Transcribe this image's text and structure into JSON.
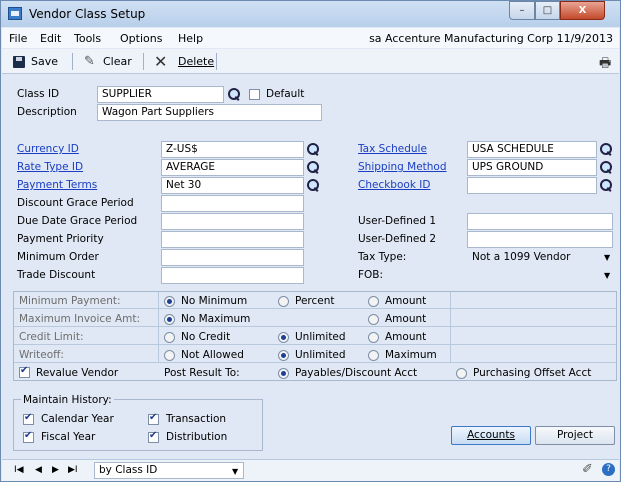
{
  "window": {
    "title": "Vendor Class Setup",
    "min": "–",
    "max": "□",
    "close": "X"
  },
  "menu": {
    "items": [
      "File",
      "Edit",
      "Tools",
      "Options",
      "Help"
    ],
    "company": "sa  Accenture Manufacturing Corp  11/9/2013"
  },
  "toolbar": {
    "save": "Save",
    "clear": "Clear",
    "delete": "Delete"
  },
  "header": {
    "class_id_label": "Class ID",
    "class_id": "SUPPLIER",
    "default_label": "Default",
    "description_label": "Description",
    "description": "Wagon Part Suppliers"
  },
  "fields": {
    "currency_id_label": "Currency ID",
    "currency_id": "Z-US$",
    "rate_type_label": "Rate Type ID",
    "rate_type": "AVERAGE",
    "payment_terms_label": "Payment Terms",
    "payment_terms": "Net 30",
    "discount_grace_label": "Discount Grace Period",
    "discount_grace": "",
    "due_date_grace_label": "Due Date Grace Period",
    "due_date_grace": "",
    "payment_priority_label": "Payment Priority",
    "payment_priority": "",
    "minimum_order_label": "Minimum Order",
    "minimum_order": "",
    "trade_discount_label": "Trade Discount",
    "trade_discount": "",
    "tax_schedule_label": "Tax Schedule",
    "tax_schedule": "USA SCHEDULE",
    "shipping_method_label": "Shipping Method",
    "shipping_method": "UPS GROUND",
    "checkbook_label": "Checkbook ID",
    "checkbook": "",
    "user_defined1_label": "User-Defined 1",
    "user_defined1": "",
    "user_defined2_label": "User-Defined 2",
    "user_defined2": "",
    "tax_type_label": "Tax Type:",
    "tax_type": "Not a 1099 Vendor",
    "fob_label": "FOB:",
    "fob": ""
  },
  "options": {
    "min_payment_label": "Minimum Payment:",
    "no_minimum": "No Minimum",
    "percent": "Percent",
    "amount": "Amount",
    "max_invoice_label": "Maximum Invoice Amt:",
    "no_maximum": "No Maximum",
    "credit_limit_label": "Credit Limit:",
    "no_credit": "No Credit",
    "unlimited": "Unlimited",
    "writeoff_label": "Writeoff:",
    "not_allowed": "Not Allowed",
    "maximum": "Maximum",
    "revalue_label": "Revalue Vendor",
    "post_result_label": "Post Result To:",
    "payables_discount": "Payables/Discount Acct",
    "purchasing_offset": "Purchasing Offset Acct"
  },
  "history": {
    "title": "Maintain History:",
    "calendar_year": "Calendar Year",
    "transaction": "Transaction",
    "fiscal_year": "Fiscal Year",
    "distribution": "Distribution"
  },
  "buttons": {
    "accounts": "Accounts",
    "project": "Project"
  },
  "status": {
    "first": "I◀",
    "prev": "◀",
    "next": "▶",
    "last": "▶I",
    "sort": "by Class ID"
  }
}
